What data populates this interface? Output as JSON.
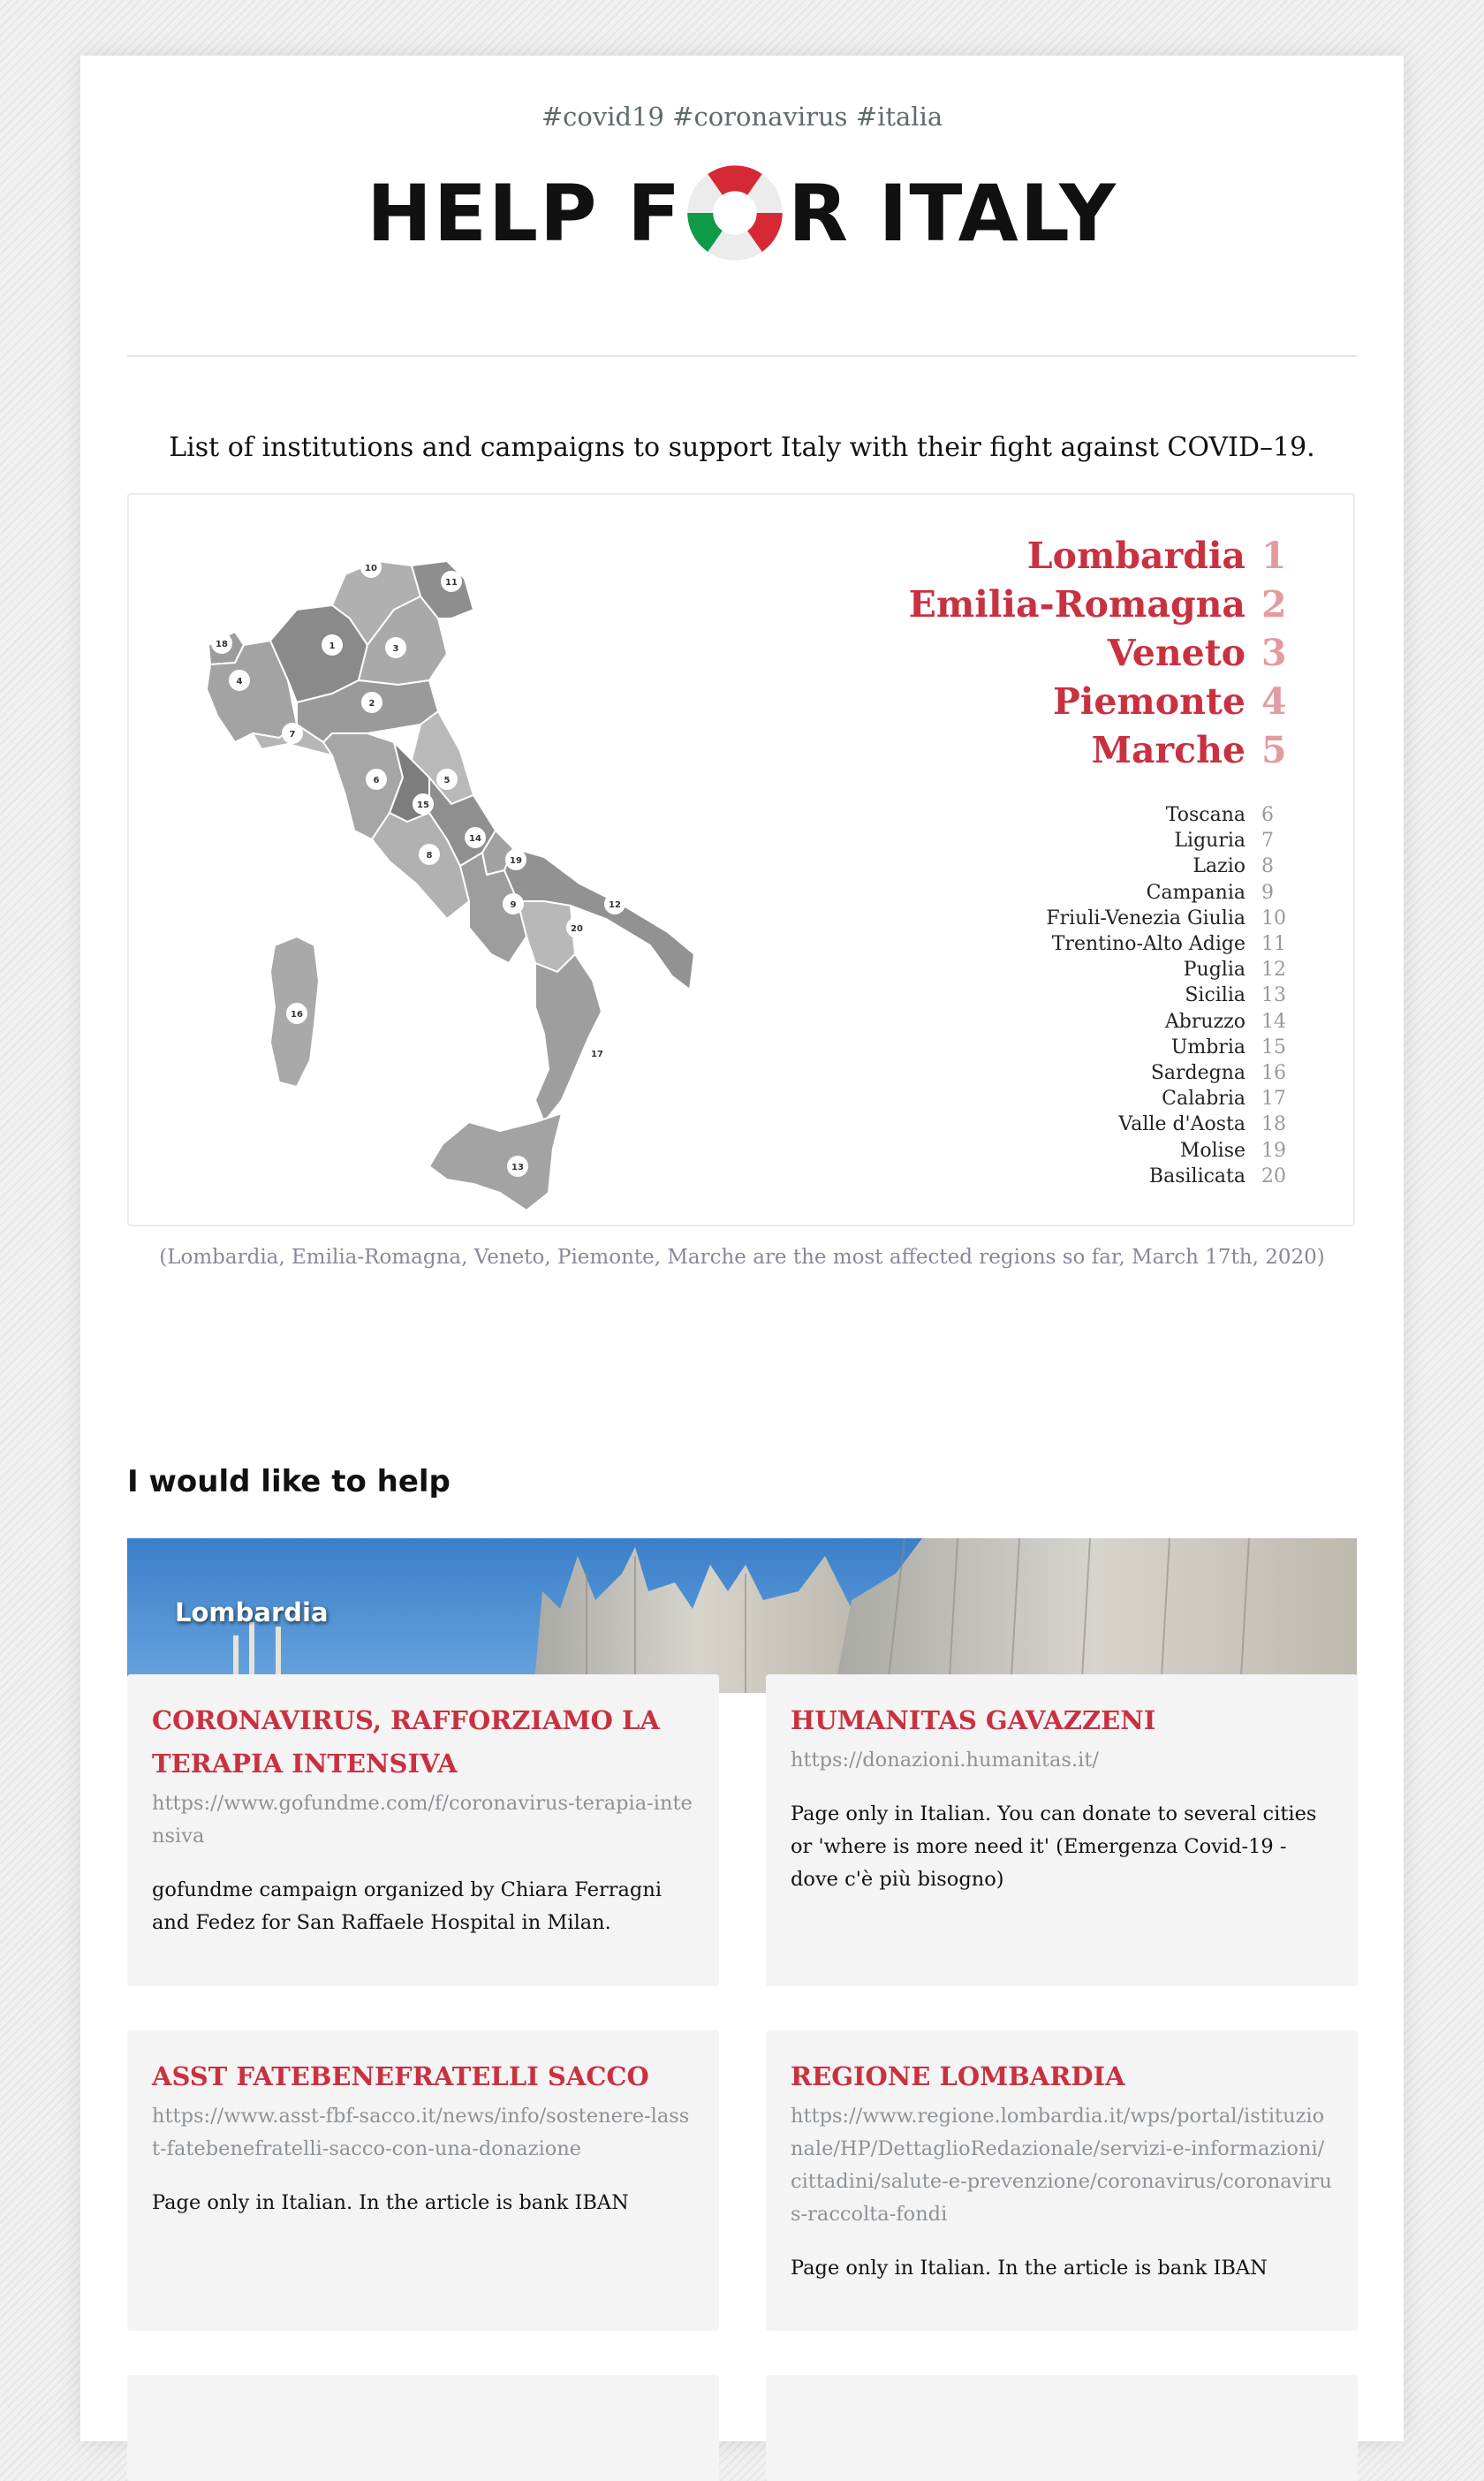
{
  "header": {
    "hashtags": "#covid19 #coronavirus #italia",
    "logo_left": "HELP F",
    "logo_right": "R ITALY"
  },
  "intro": "List of institutions and campaigns to support Italy with their fight against COVID–19.",
  "colors": {
    "accent": "#c93140",
    "accent_light": "#e39aa1",
    "italy_green": "#0f9a48",
    "italy_red": "#d52a35"
  },
  "map": {
    "top_regions": [
      {
        "name": "Lombardia",
        "rank": "1"
      },
      {
        "name": "Emilia-Romagna",
        "rank": "2"
      },
      {
        "name": "Veneto",
        "rank": "3"
      },
      {
        "name": "Piemonte",
        "rank": "4"
      },
      {
        "name": "Marche",
        "rank": "5"
      }
    ],
    "other_regions": [
      {
        "name": "Toscana",
        "rank": "6"
      },
      {
        "name": "Liguria",
        "rank": "7"
      },
      {
        "name": "Lazio",
        "rank": "8"
      },
      {
        "name": "Campania",
        "rank": "9"
      },
      {
        "name": "Friuli-Venezia Giulia",
        "rank": "10"
      },
      {
        "name": "Trentino-Alto Adige",
        "rank": "11"
      },
      {
        "name": "Puglia",
        "rank": "12"
      },
      {
        "name": "Sicilia",
        "rank": "13"
      },
      {
        "name": "Abruzzo",
        "rank": "14"
      },
      {
        "name": "Umbria",
        "rank": "15"
      },
      {
        "name": "Sardegna",
        "rank": "16"
      },
      {
        "name": "Calabria",
        "rank": "17"
      },
      {
        "name": "Valle d'Aosta",
        "rank": "18"
      },
      {
        "name": "Molise",
        "rank": "19"
      },
      {
        "name": "Basilicata",
        "rank": "20"
      }
    ],
    "caption": "(Lombardia, Emilia-Romagna, Veneto, Piemonte, Marche are the most affected regions so far, March 17th, 2020)"
  },
  "help": {
    "title": "I would like to help",
    "banner_label": "Lombardia",
    "cards": [
      {
        "title": "CORONAVIRUS, RAFFORZIAMO LA TERAPIA INTENSIVA",
        "url": "https://www.gofundme.com/f/coronavirus-terapia-intensiva",
        "desc": "gofundme campaign organized by Chiara Ferragni and Fedez for San Raffaele Hospital in Milan."
      },
      {
        "title": "HUMANITAS GAVAZZENI",
        "url": "https://donazioni.humanitas.it/",
        "desc": "Page only in Italian. You can donate to several cities or 'where is more need it' (Emergenza Covid-19 - dove c'è più bisogno)"
      },
      {
        "title": "ASST FATEBENEFRATELLI SACCO",
        "url": "https://www.asst-fbf-sacco.it/news/info/sostenere-lasst-fatebenefratelli-sacco-con-una-donazione",
        "desc": "Page only in Italian. In the article is bank IBAN"
      },
      {
        "title": "REGIONE LOMBARDIA",
        "url": "https://www.regione.lombardia.it/wps/portal/istituzionale/HP/DettaglioRedazionale/servizi-e-informazioni/cittadini/salute-e-prevenzione/coronavirus/coronavirus-raccolta-fondi",
        "desc": "Page only in Italian. In the article is bank IBAN"
      }
    ]
  }
}
